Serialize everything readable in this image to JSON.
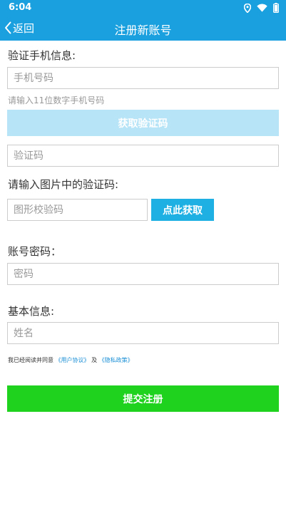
{
  "status_bar": {
    "time": "6:04"
  },
  "header": {
    "back_label": "返回",
    "title": "注册新账号"
  },
  "phone_section": {
    "label": "验证手机信息:",
    "phone_placeholder": "手机号码",
    "hint": "请输入11位数字手机号码",
    "get_code_label": "获取验证码",
    "code_placeholder": "验证码"
  },
  "captcha_section": {
    "label": "请输入图片中的验证码:",
    "captcha_placeholder": "图形校验码",
    "refresh_label": "点此获取"
  },
  "password_section": {
    "label": "账号密码：",
    "password_placeholder": "密码"
  },
  "basic_section": {
    "label": "基本信息:",
    "name_placeholder": "姓名"
  },
  "agreement": {
    "prefix": "我已经阅读并同意",
    "user_agreement": "《用户协议》",
    "conjunction": "及",
    "privacy_policy": "《隐私政策》"
  },
  "submit_label": "提交注册",
  "colors": {
    "header": "#1aa0df",
    "code_button_disabled": "#b7e4f6",
    "captcha_button": "#1eb0e3",
    "submit_button": "#1ed21e",
    "link": "#1a8fd6"
  },
  "icons": [
    "location-icon",
    "wifi-icon",
    "battery-icon",
    "back-chevron-icon"
  ]
}
